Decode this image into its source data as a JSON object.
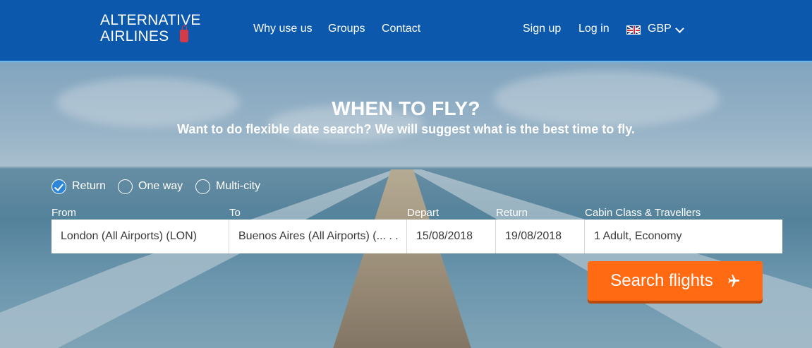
{
  "header": {
    "logo_line1": "ALTERNATIVE",
    "logo_line2": "AIRLINES",
    "nav": [
      "Why use us",
      "Groups",
      "Contact"
    ],
    "signup": "Sign up",
    "login": "Log in",
    "currency": "GBP",
    "currency_flag": "uk-flag-icon"
  },
  "hero": {
    "title": "WHEN TO FLY?",
    "subtitle": "Want to do flexible date search? We will suggest what is the best time to fly."
  },
  "trip_types": [
    {
      "label": "Return",
      "checked": true
    },
    {
      "label": "One way",
      "checked": false
    },
    {
      "label": "Multi-city",
      "checked": false
    }
  ],
  "form": {
    "labels": {
      "from": "From",
      "to": "To",
      "depart": "Depart",
      "return": "Return",
      "cabin": "Cabin Class & Travellers"
    },
    "values": {
      "from": "London (All Airports) (LON)",
      "to": "Buenos Aires (All Airports) (... . .",
      "depart": "15/08/2018",
      "return": "19/08/2018",
      "cabin": "1 Adult, Economy"
    }
  },
  "search_button": "Search flights",
  "colors": {
    "header_bg": "#0b58ad",
    "search_button": "#ff6a13",
    "radio_checked": "#2e86d8"
  }
}
